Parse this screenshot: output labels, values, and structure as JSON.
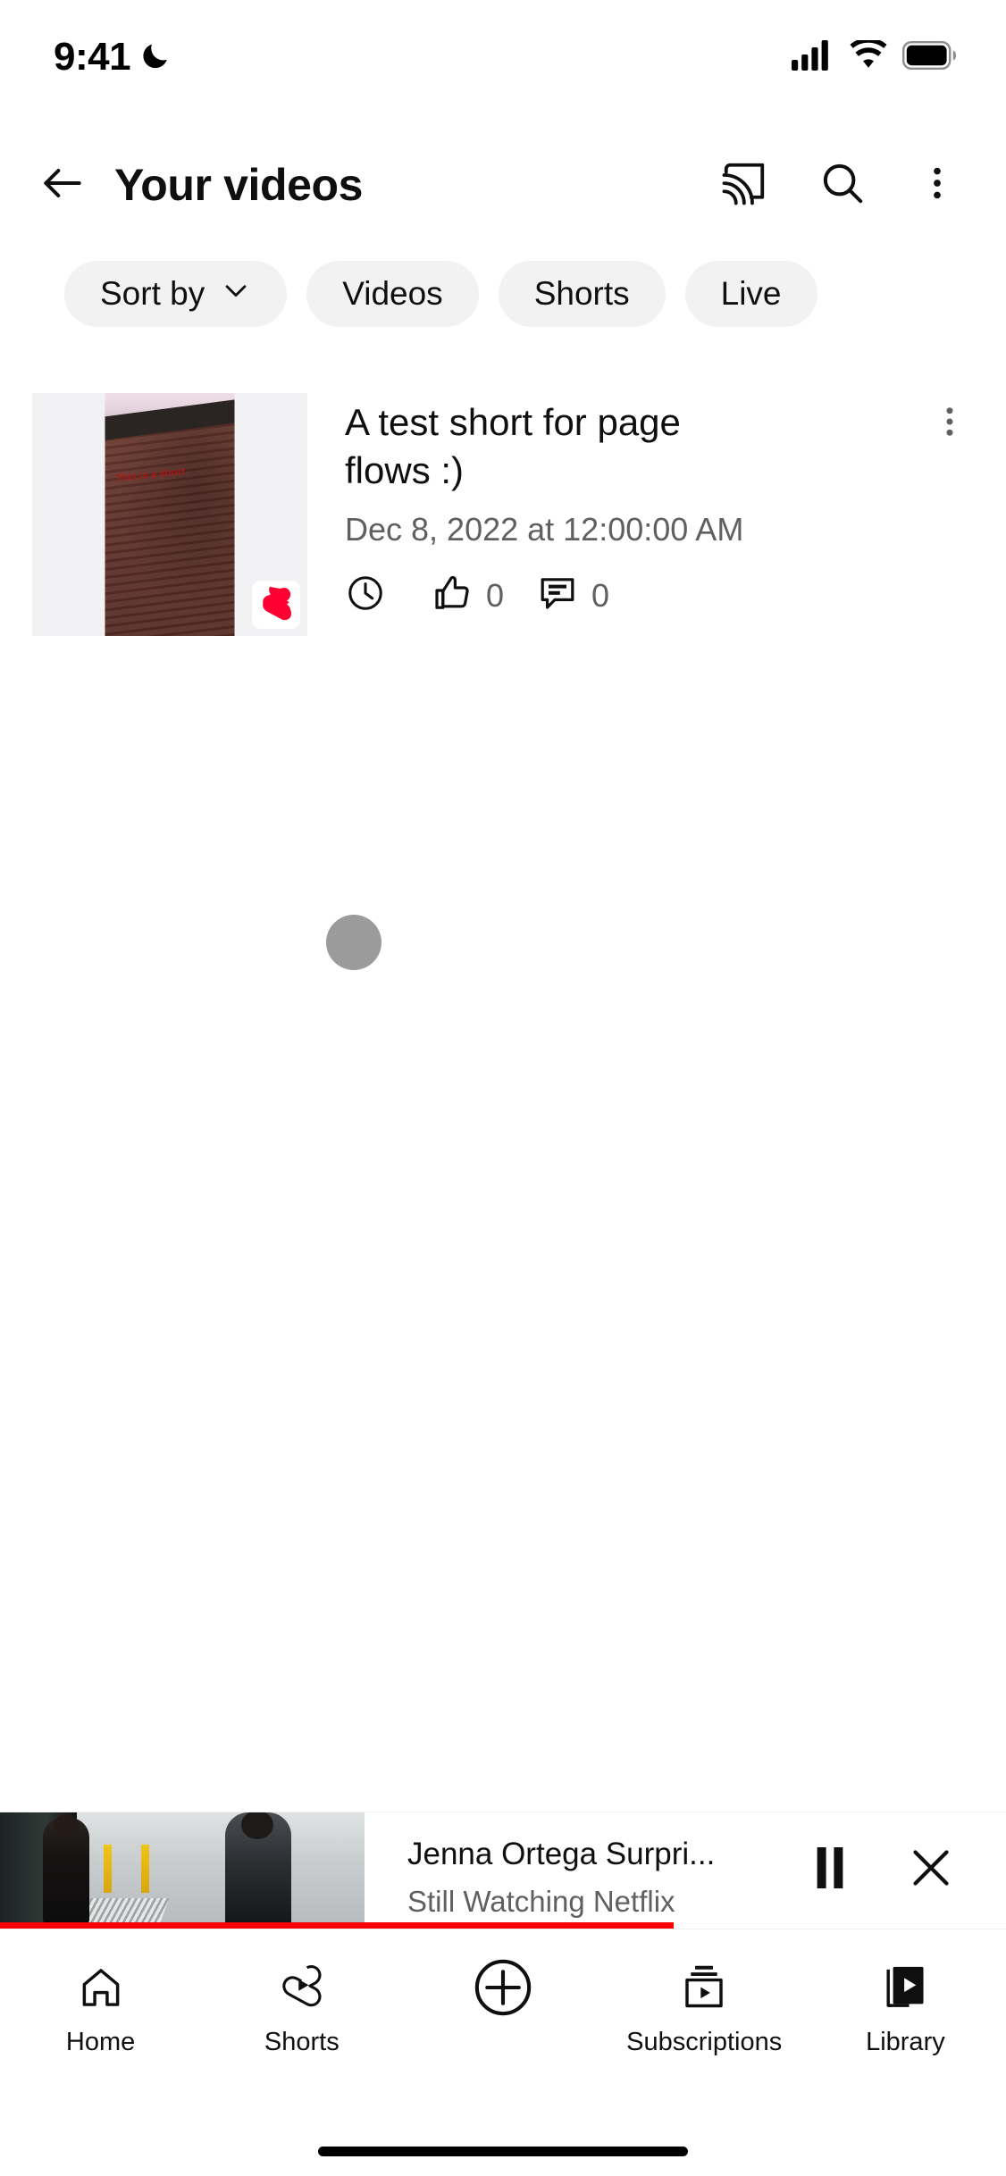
{
  "status_bar": {
    "time": "9:41",
    "dnd_icon": "crescent-moon-icon",
    "signal_icon": "cellular-signal-icon",
    "wifi_icon": "wifi-icon",
    "battery_icon": "battery-full-icon"
  },
  "header": {
    "back_icon": "back-arrow-icon",
    "title": "Your videos",
    "cast_icon": "cast-icon",
    "search_icon": "search-icon",
    "overflow_icon": "more-vertical-icon"
  },
  "filter_chips": [
    {
      "label": "Sort by",
      "has_chevron": true,
      "icon": "chevron-down-icon"
    },
    {
      "label": "Videos",
      "has_chevron": false
    },
    {
      "label": "Shorts",
      "has_chevron": false
    },
    {
      "label": "Live",
      "has_chevron": false
    }
  ],
  "video": {
    "title": "A test short for page flows :)",
    "date": "Dec 8, 2022 at 12:00:00 AM",
    "thumbnail_caption": "This is a short",
    "shorts_badge_icon": "shorts-logo-icon",
    "kebab_icon": "more-vertical-icon",
    "stats": [
      {
        "icon": "clock-icon",
        "value": ""
      },
      {
        "icon": "thumbs-up-icon",
        "value": "0"
      },
      {
        "icon": "comment-icon",
        "value": "0"
      }
    ]
  },
  "loading": {
    "spinner_label": "loading-spinner"
  },
  "mini_player": {
    "title": "Jenna Ortega Surpri...",
    "channel": "Still Watching Netflix",
    "pause_icon": "pause-icon",
    "close_icon": "close-icon",
    "progress_percent": 67
  },
  "bottom_nav": [
    {
      "label": "Home",
      "icon": "home-icon",
      "selected": false
    },
    {
      "label": "Shorts",
      "icon": "shorts-icon",
      "selected": false
    },
    {
      "label": "",
      "icon": "create-plus-icon",
      "selected": false
    },
    {
      "label": "Subscriptions",
      "icon": "subscriptions-icon",
      "selected": false
    },
    {
      "label": "Library",
      "icon": "library-icon",
      "selected": true
    }
  ],
  "colors": {
    "accent_red": "#ff0000",
    "text_primary": "#0f0f0f",
    "text_secondary": "#606060",
    "chip_bg": "#f2f2f2",
    "thumb_bg": "#f2f1f3"
  }
}
